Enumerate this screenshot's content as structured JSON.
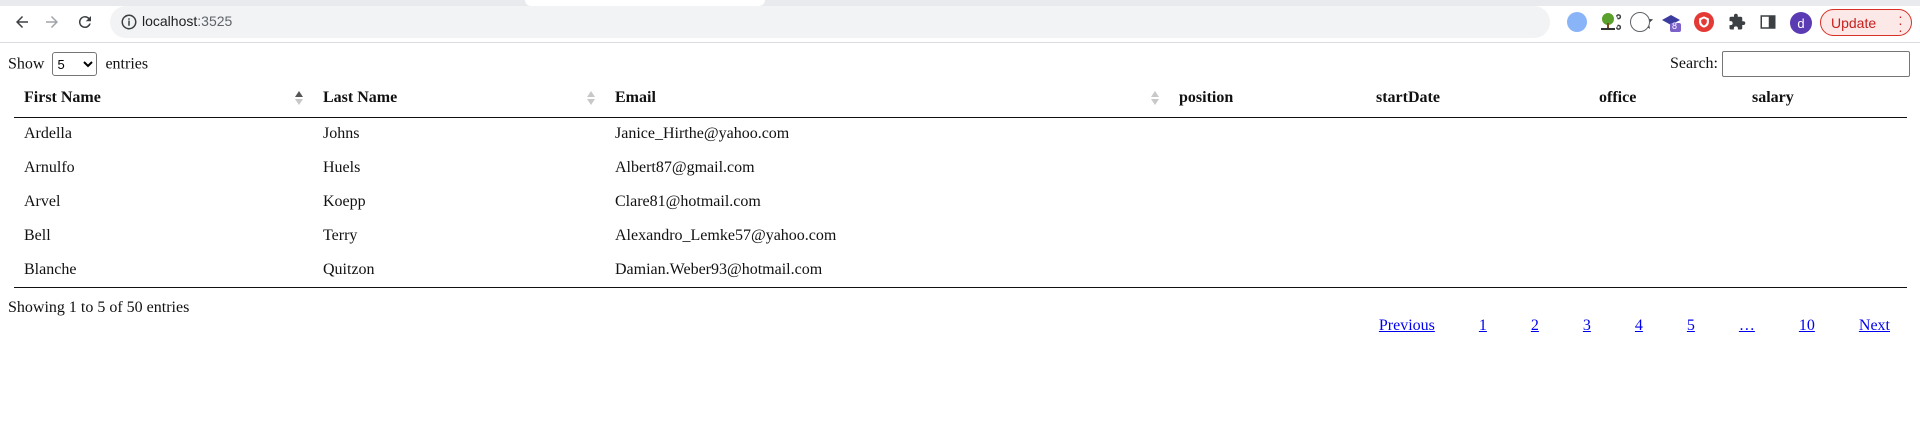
{
  "browser": {
    "url_host": "localhost",
    "url_port": ":3525",
    "avatar_letter": "d",
    "update_label": "Update",
    "extension_badge": "8"
  },
  "length_menu": {
    "prefix": "Show",
    "selected": "5",
    "options": [
      "5"
    ],
    "suffix": "entries"
  },
  "search": {
    "label": "Search:",
    "value": ""
  },
  "table": {
    "headers": [
      "First Name",
      "Last Name",
      "Email",
      "position",
      "startDate",
      "office",
      "salary"
    ],
    "rows": [
      [
        "Ardella",
        "Johns",
        "Janice_Hirthe@yahoo.com",
        "",
        "",
        "",
        ""
      ],
      [
        "Arnulfo",
        "Huels",
        "Albert87@gmail.com",
        "",
        "",
        "",
        ""
      ],
      [
        "Arvel",
        "Koepp",
        "Clare81@hotmail.com",
        "",
        "",
        "",
        ""
      ],
      [
        "Bell",
        "Terry",
        "Alexandro_Lemke57@yahoo.com",
        "",
        "",
        "",
        ""
      ],
      [
        "Blanche",
        "Quitzon",
        "Damian.Weber93@hotmail.com",
        "",
        "",
        "",
        ""
      ]
    ]
  },
  "info": "Showing 1 to 5 of 50 entries",
  "pagination": {
    "previous": "Previous",
    "pages": [
      "1",
      "2",
      "3",
      "4",
      "5",
      "…",
      "10"
    ],
    "next": "Next"
  },
  "colors": {
    "link": "#0000ee",
    "update_border": "#d93025",
    "avatar": "#5b3bb3"
  }
}
